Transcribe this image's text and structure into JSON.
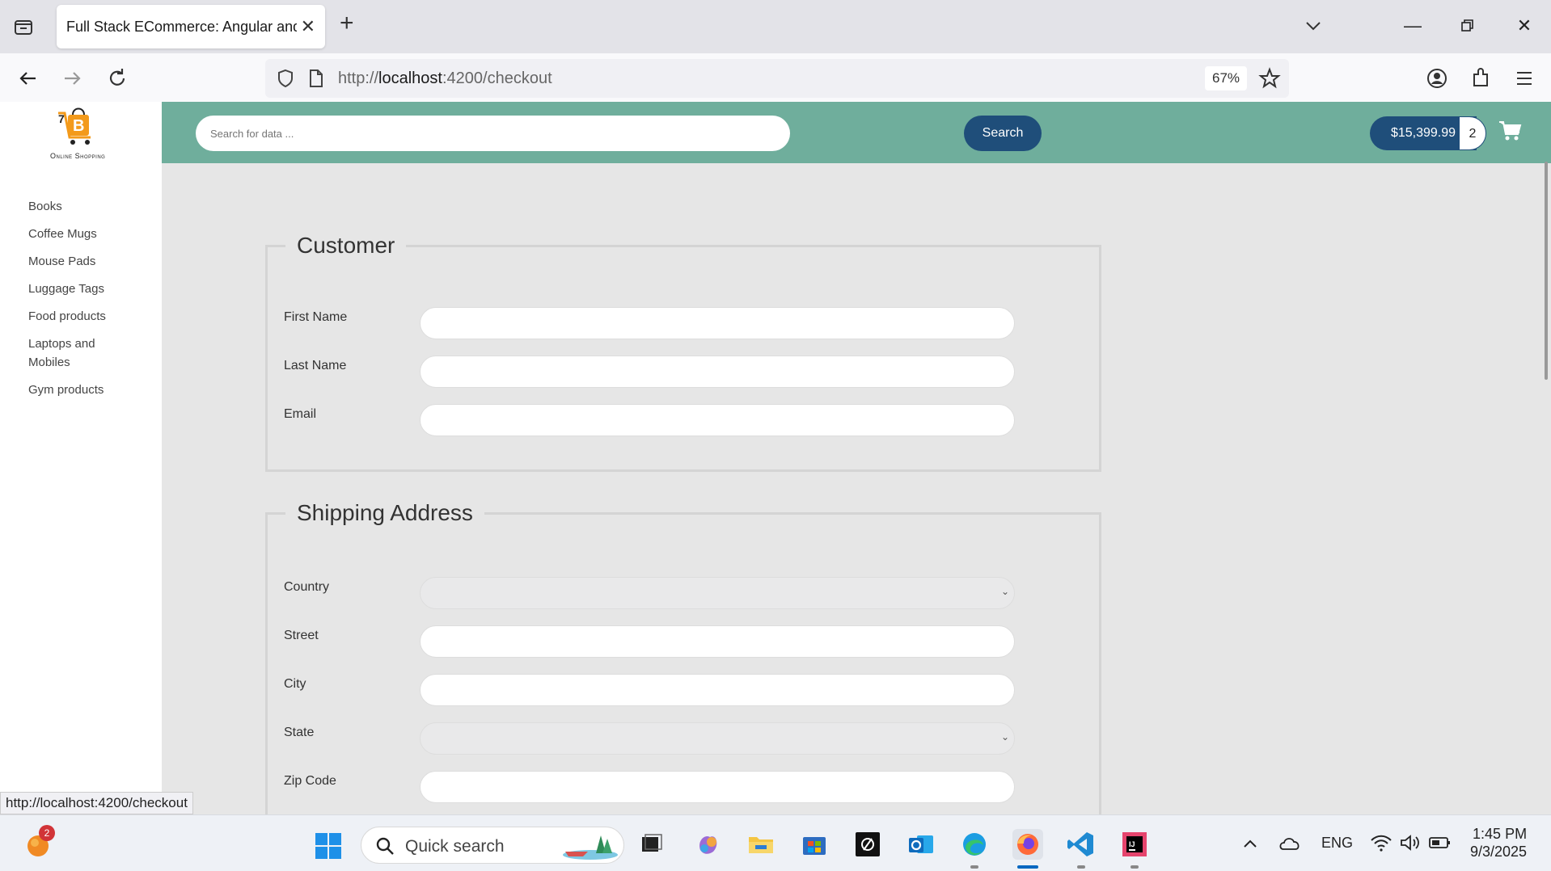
{
  "browser": {
    "tab_title": "Full Stack ECommerce: Angular and",
    "url_scheme": "http://",
    "url_host": "localhost",
    "url_rest": ":4200/checkout",
    "zoom": "67%",
    "status_url": "http://localhost:4200/checkout"
  },
  "sidebar": {
    "logo_text": "Online Shopping",
    "categories": [
      {
        "label": "Books"
      },
      {
        "label": "Coffee Mugs"
      },
      {
        "label": "Mouse Pads"
      },
      {
        "label": "Luggage Tags"
      },
      {
        "label": "Food products"
      },
      {
        "label": "Laptops and Mobiles"
      },
      {
        "label": "Gym products"
      }
    ]
  },
  "header": {
    "search_placeholder": "Search for data ...",
    "search_button": "Search",
    "cart_total": "$15,399.99",
    "cart_count": "2"
  },
  "customer": {
    "title": "Customer",
    "fields": [
      {
        "label": "First Name",
        "value": ""
      },
      {
        "label": "Last Name",
        "value": ""
      },
      {
        "label": "Email",
        "value": ""
      }
    ]
  },
  "shipping": {
    "title": "Shipping Address",
    "fields": [
      {
        "label": "Country",
        "value": ""
      },
      {
        "label": "Street",
        "value": ""
      },
      {
        "label": "City",
        "value": ""
      },
      {
        "label": "State",
        "value": ""
      },
      {
        "label": "Zip Code",
        "value": ""
      }
    ]
  },
  "taskbar": {
    "widget_badge": "2",
    "search_text": "Quick search",
    "language": "ENG",
    "time": "1:45 PM",
    "date": "9/3/2025"
  },
  "colors": {
    "header_bg": "#6fae9c",
    "primary_button": "#1f4e7a"
  }
}
